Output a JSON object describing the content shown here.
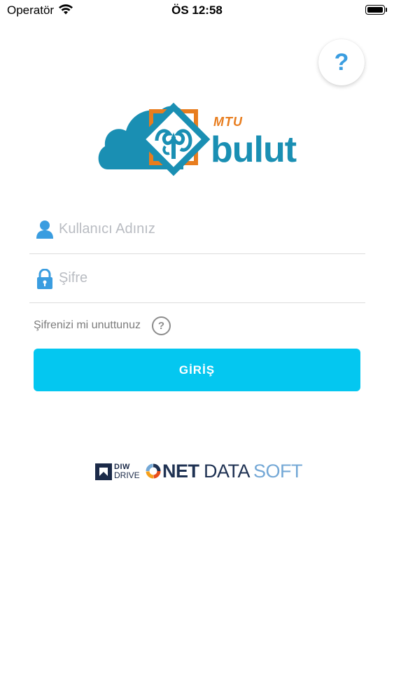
{
  "status_bar": {
    "carrier": "Operatör",
    "time": "ÖS 12:58",
    "wifi_icon": "wifi-icon",
    "battery_icon": "battery-icon"
  },
  "help": {
    "label": "?"
  },
  "logo": {
    "mtu": "MTU",
    "bulut": "bulut",
    "colors": {
      "cloud": "#1a8fb3",
      "frame": "#e87d1e"
    }
  },
  "login_form": {
    "username_placeholder": "Kullanıcı Adınız",
    "username_value": "",
    "password_placeholder": "Şifre",
    "password_value": "",
    "user_icon": "user-icon",
    "lock_icon": "lock-icon",
    "forgot_password": "Şifrenizi mi unuttunuz",
    "forgot_help": "?",
    "login_button": "GİRİŞ",
    "accent_color": "#04c7f0"
  },
  "footer": {
    "diw_line1": "DIW",
    "diw_line2": "DRIVE",
    "net": "NET",
    "data": "DATA",
    "soft": "SOFT"
  }
}
